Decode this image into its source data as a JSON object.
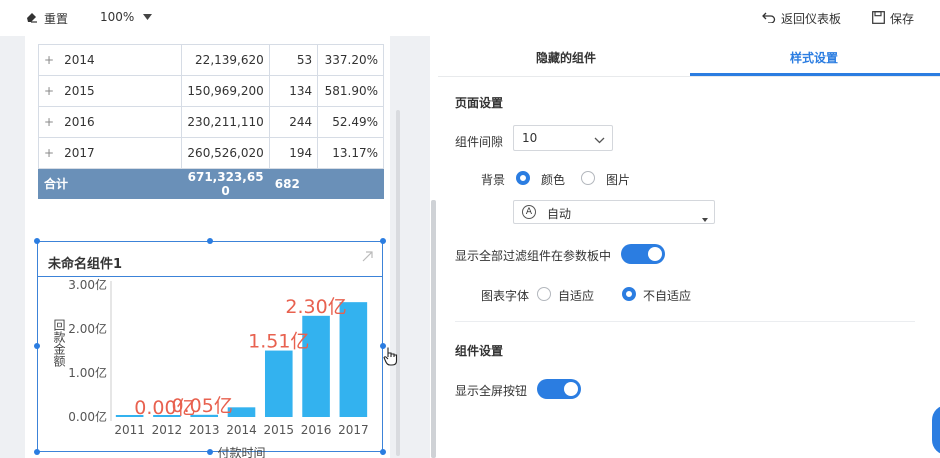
{
  "toolbar": {
    "reset_label": "重置",
    "zoom_label": "100%",
    "back_label": "返回仪表板",
    "save_label": "保存"
  },
  "table": {
    "rows": [
      {
        "year": "2014",
        "amount": "22,139,620",
        "count": "53",
        "rate": "337.20%"
      },
      {
        "year": "2015",
        "amount": "150,969,200",
        "count": "134",
        "rate": "581.90%"
      },
      {
        "year": "2016",
        "amount": "230,211,110",
        "count": "244",
        "rate": "52.49%"
      },
      {
        "year": "2017",
        "amount": "260,526,020",
        "count": "194",
        "rate": "13.17%"
      }
    ],
    "total": {
      "label": "合计",
      "amount_line1": "671,323,65",
      "amount_line2": "0",
      "count": "682"
    }
  },
  "widget": {
    "title": "未命名组件1"
  },
  "chart_data": {
    "type": "bar",
    "categories": [
      "2011",
      "2012",
      "2013",
      "2014",
      "2015",
      "2016",
      "2017"
    ],
    "values": [
      0.0,
      0.0,
      0.05,
      0.22,
      1.51,
      2.3,
      2.61
    ],
    "data_labels": [
      {
        "index": 1,
        "text": "0.00亿"
      },
      {
        "index": 2,
        "text": "0.05亿"
      },
      {
        "index": 4,
        "text": "1.51亿"
      },
      {
        "index": 5,
        "text": "2.30亿"
      }
    ],
    "ylabel": "回款金额",
    "xlabel": "付款时间",
    "yticks": [
      "0.00亿",
      "1.00亿",
      "2.00亿",
      "3.00亿"
    ],
    "ylim": [
      0,
      3
    ],
    "bar_color": "#33b2ef",
    "label_color": "#e8614f"
  },
  "panel": {
    "tab_hidden": "隐藏的组件",
    "tab_style": "样式设置",
    "page_settings_title": "页面设置",
    "gap_label": "组件间隙",
    "gap_value": "10",
    "bg_label": "背景",
    "bg_opt_color": "颜色",
    "bg_opt_image": "图片",
    "bg_select_value": "自动",
    "bg_select_icon_letter": "A",
    "show_filter_label": "显示全部过滤组件在参数板中",
    "font_label": "图表字体",
    "font_opt_auto": "自适应",
    "font_opt_noauto": "不自适应",
    "widget_settings_title": "组件设置",
    "fullscreen_label": "显示全屏按钮"
  },
  "colors": {
    "accent": "#2b7de1",
    "table_total": "#6a90b8"
  }
}
